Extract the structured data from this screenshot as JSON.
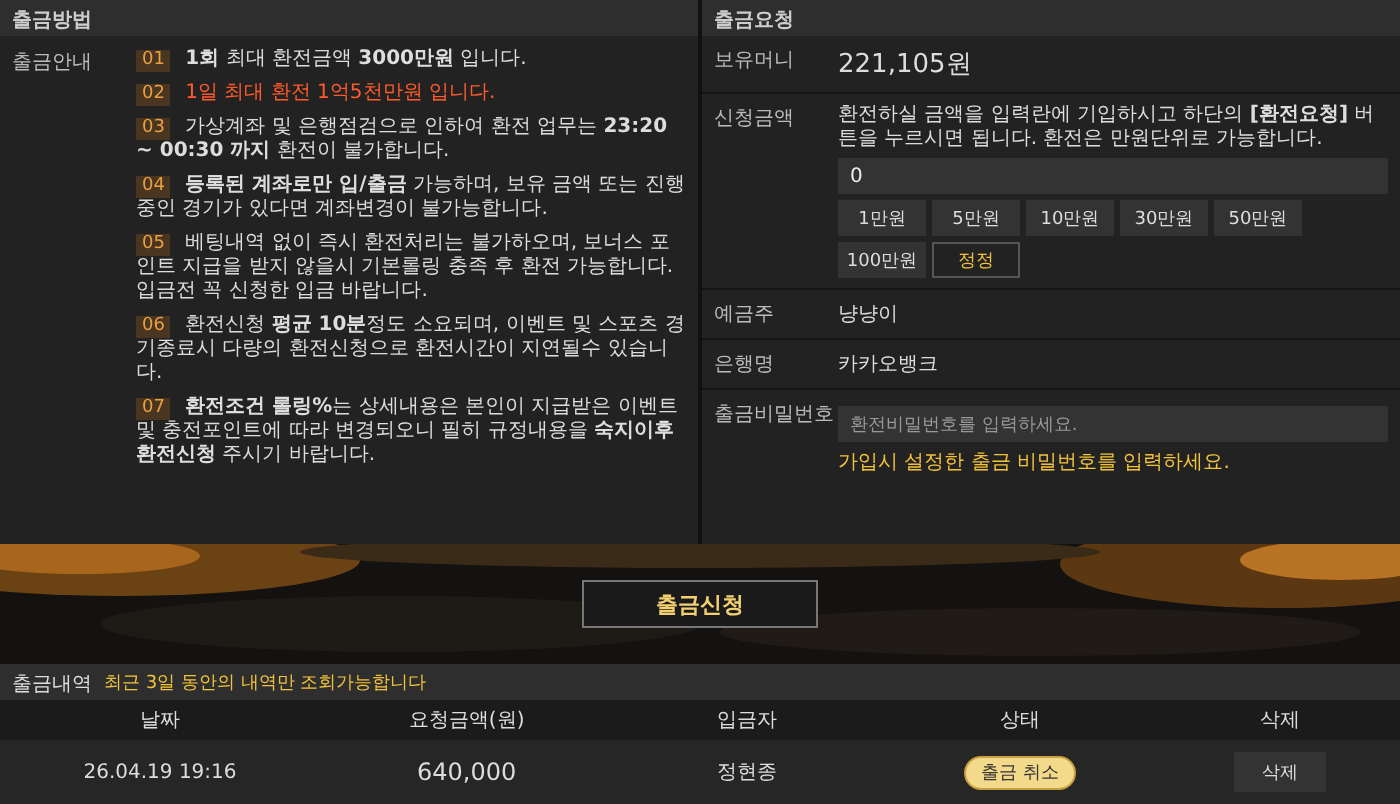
{
  "method_panel": {
    "title": "출금방법",
    "label": "출금안내",
    "items": [
      {
        "number": "01",
        "kind": "normal",
        "text": "**1회** 최대 환전금액 **3000만원** 입니다."
      },
      {
        "number": "02",
        "kind": "alert",
        "text": "1일 최대 환전 1억5천만원 입니다."
      },
      {
        "number": "03",
        "kind": "normal",
        "text": "가상계좌 및 은행점검으로 인하여 환전 업무는 **23:20 ~ 00:30 까지** 환전이 불가합니다."
      },
      {
        "number": "04",
        "kind": "normal",
        "text": "**등록된 계좌로만 입/출금** 가능하며, 보유 금액 또는 진행중인 경기가 있다면 계좌변경이 불가능합니다."
      },
      {
        "number": "05",
        "kind": "normal",
        "text": "베팅내역 없이 즉시 환전처리는 불가하오며, 보너스 포인트 지급을 받지 않을시 기본롤링 충족 후 환전 가능합니다.",
        "note": "입금전 꼭 신청한 입금 바랍니다."
      },
      {
        "number": "06",
        "kind": "normal",
        "text": "환전신청 **평균 10분**정도 소요되며, 이벤트 및 스포츠 경기종료시 다량의 환전신청으로 환전시간이 지연될수 있습니다."
      },
      {
        "number": "07",
        "kind": "normal",
        "text": "**환전조건 롤링%**는 상세내용은 본인이 지급받은 이벤트 및 충전포인트에 따라 변경되오니 필히 규정내용을 **숙지이후 환전신청** 주시기 바랍니다."
      }
    ]
  },
  "request_panel": {
    "title": "출금요청",
    "balance": {
      "label": "보유머니",
      "value": "221,105원"
    },
    "amount": {
      "label": "신청금액",
      "description": "환전하실 금액을 입력란에 기입하시고 하단의 **[환전요청]** 버튼을 누르시면 됩니다. 환전은 만원단위로 가능합니다.",
      "value": "0",
      "buttons": [
        {
          "label": "1만원",
          "kind": "amount"
        },
        {
          "label": "5만원",
          "kind": "amount"
        },
        {
          "label": "10만원",
          "kind": "amount"
        },
        {
          "label": "30만원",
          "kind": "amount"
        },
        {
          "label": "50만원",
          "kind": "amount"
        },
        {
          "label": "100만원",
          "kind": "amount"
        },
        {
          "label": "정정",
          "kind": "reset"
        }
      ]
    },
    "holder": {
      "label": "예금주",
      "value": "냥냥이"
    },
    "bank": {
      "label": "은행명",
      "value": "카카오뱅크"
    },
    "password": {
      "label": "출금비밀번호",
      "placeholder": "환전비밀번호를 입력하세요.",
      "hint": "가입시 설정한 출금 비밀번호를 입력하세요."
    }
  },
  "submit_button": "출금신청",
  "history": {
    "title": "출금내역",
    "note": "최근 3일 동안의 내역만 조회가능합니다",
    "columns": [
      "날짜",
      "요청금액(원)",
      "입금자",
      "상태",
      "삭제"
    ],
    "rows": [
      {
        "date": "26.04.19 19:16",
        "amount": "640,000",
        "depositor": "정현종",
        "status": "출금 취소",
        "action": "삭제"
      }
    ]
  }
}
